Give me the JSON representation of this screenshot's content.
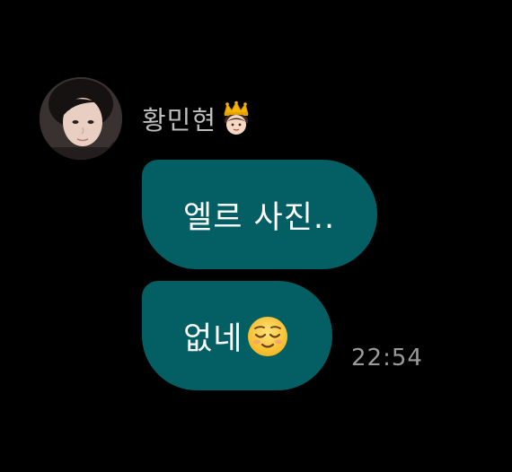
{
  "conversation": {
    "sender": {
      "name": "황민현",
      "badge_icon": "prince-crown-emoji-icon",
      "avatar": "profile-photo-avatar"
    },
    "messages": [
      {
        "text": "엘르 사진..",
        "emoji": ""
      },
      {
        "text": "없네",
        "emoji": "relieved-face-emoji-icon"
      }
    ],
    "timestamp": "22:54"
  },
  "colors": {
    "background": "#000000",
    "bubble": "#035f63",
    "bubble_text": "#ffffff",
    "sender_name": "#bdbdbd",
    "timestamp": "#9a9a9a"
  }
}
